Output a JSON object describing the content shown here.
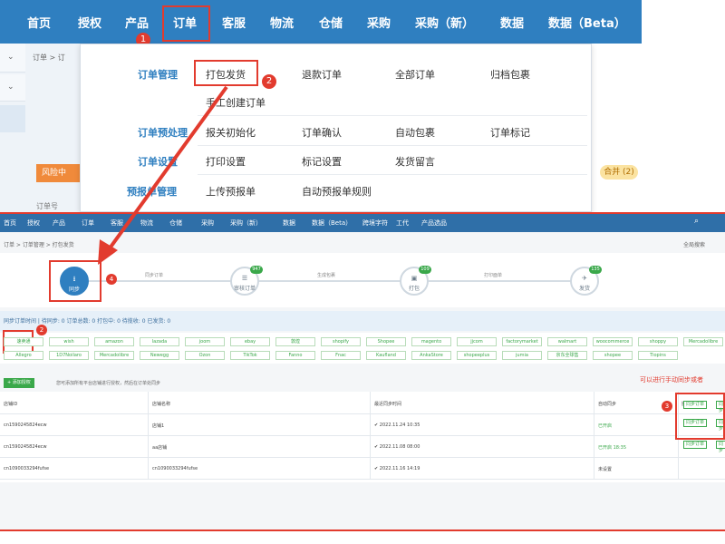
{
  "top_nav": {
    "items": [
      "首页",
      "授权",
      "产品",
      "订单",
      "客服",
      "物流",
      "仓储",
      "采购",
      "采购（新）",
      "数据",
      "数据（Beta）"
    ],
    "active": "订单"
  },
  "annotations": {
    "n1": "1",
    "n2": "2",
    "n3": "3",
    "n4": "4"
  },
  "left_panel": {
    "breadcrumb": "订单 > 订",
    "risk": "风险中",
    "list_label": "订单号"
  },
  "dropdown": {
    "groups": [
      {
        "title": "订单管理",
        "items": [
          "打包发货",
          "退款订单",
          "全部订单",
          "归档包裹",
          "手工创建订单"
        ]
      },
      {
        "title": "订单预处理",
        "items": [
          "报关初始化",
          "订单确认",
          "自动包裹",
          "订单标记"
        ]
      },
      {
        "title": "订单设置",
        "items": [
          "打印设置",
          "标记设置",
          "发货留言"
        ]
      },
      {
        "title": "预报单管理",
        "items": [
          "上传预报单",
          "自动预报单规则"
        ]
      }
    ]
  },
  "yellow_badge": "合并 (2)",
  "small_nav": {
    "items": [
      "首页",
      "授权",
      "产品",
      "订单",
      "客服",
      "物流",
      "仓储",
      "采购",
      "采购（新）",
      "数据",
      "数据（Beta）",
      "跨境字符",
      "工代",
      "产品选品"
    ],
    "right": "全局搜索"
  },
  "small_crumb": "订单 > 订单管理 > 打包发货",
  "flow": {
    "steps": [
      {
        "label": "同步",
        "badge": ""
      },
      {
        "label": "审核订单",
        "badge": "947"
      },
      {
        "label": "打包",
        "badge": "109"
      },
      {
        "label": "发货",
        "badge": "135"
      }
    ],
    "connectors": [
      "同步订单",
      "生成包裹",
      "打印面单"
    ]
  },
  "info_bar": "同步订单时间 | 待同步: 0  订单总数: 0  打包中: 0  待揽收: 0  已发货: 0",
  "platforms_row1": [
    "速卖通",
    "wish",
    "amazon",
    "lazada",
    "joom",
    "ebay",
    "敦煌",
    "shopify",
    "Shopee",
    "magento",
    "jjcom",
    "factorymarket",
    "walmart",
    "woocommerce",
    "shoppy",
    "Mercadolibre"
  ],
  "platforms_row2": [
    "Allegro",
    "1D7Noilaro",
    "Mercadolibre",
    "Newegg",
    "Ozon",
    "TikTok",
    "Fanno",
    "Fnac",
    "Kaufland",
    "AnkaStore",
    "shopeeplus",
    "jumia",
    "京东全球售",
    "shopee",
    "Tiopins"
  ],
  "sync_btn": "+ 添加授权",
  "sync_hint": "您可添加所有平台店铺进行授权，然后在订单处同步",
  "manual_hint": "可以进行手动同步或者",
  "table": {
    "headers": [
      "店铺ID",
      "店铺名称",
      "最近同步时间",
      "自动同步",
      "操作"
    ],
    "rows": [
      {
        "id": "cn1590245824ecw",
        "name": "店铺1",
        "time": "✔ 2022.11.24 10:35",
        "auto": "已开启",
        "btns": [
          "同步订单",
          "同步"
        ]
      },
      {
        "id": "cn1590245824ecw",
        "name": "aa店铺",
        "time": "✔ 2022.11.08 08:00",
        "auto": "已开启 18:35",
        "btns": [
          "同步订单",
          "同步"
        ]
      },
      {
        "id": "cn1090033294fufse",
        "name": "cn1090033294fufse",
        "time": "✔ 2022.11.16 14:19",
        "auto": "未设置",
        "btns": [
          "同步订单",
          "同步"
        ]
      }
    ]
  },
  "colors": {
    "nav": "#2f7fc0",
    "red": "#e23b2e",
    "green": "#3aa84a"
  }
}
